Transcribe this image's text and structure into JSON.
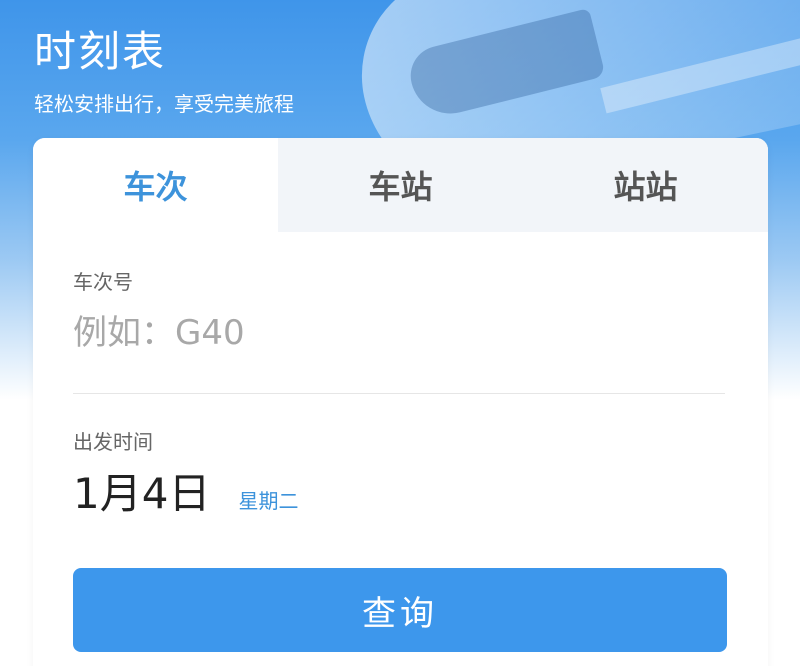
{
  "header": {
    "title": "时刻表",
    "subtitle": "轻松安排出行，享受完美旅程"
  },
  "tabs": [
    {
      "label": "车次",
      "active": true
    },
    {
      "label": "车站",
      "active": false
    },
    {
      "label": "站站",
      "active": false
    }
  ],
  "form": {
    "train_number_label": "车次号",
    "train_number_placeholder": "例如：G40",
    "departure_label": "出发时间",
    "departure_date": "1月4日",
    "departure_weekday": "星期二",
    "submit_label": "查询"
  },
  "colors": {
    "accent": "#3d93db",
    "button": "#3d97ec",
    "hero_top": "#3f95ea"
  }
}
